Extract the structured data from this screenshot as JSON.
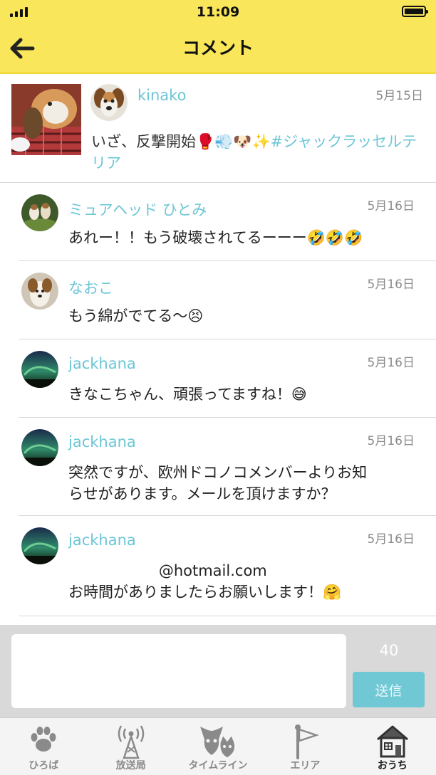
{
  "status_bar": {
    "time": "11:09"
  },
  "header": {
    "title": "コメント"
  },
  "post": {
    "user": "kinako",
    "date": "5月15日",
    "text": "いざ、反撃開始🥊💨🐶✨",
    "hashtag": "#ジャックラッセルテリア"
  },
  "comments": [
    {
      "user": "ミュアヘッド ひとみ",
      "date": "5月16日",
      "text": "あれー！！もう破壊されてるーーー🤣🤣🤣"
    },
    {
      "user": "なおこ",
      "date": "5月16日",
      "text": "もう綿がでてる〜😣"
    },
    {
      "user": "jackhana",
      "date": "5月16日",
      "text": "きなこちゃん、頑張ってますね！😅"
    },
    {
      "user": "jackhana",
      "date": "5月16日",
      "text": "突然ですが、欧州ドコノコメンバーよりお知\nらせがあります。メールを頂けますか？"
    },
    {
      "user": "jackhana",
      "date": "5月16日",
      "text": "                   @hotmail.com\nお時間がありましたらお願いします！🤗"
    }
  ],
  "composer": {
    "char_count": "40",
    "send_label": "送信",
    "placeholder": ""
  },
  "tabs": [
    {
      "label": "ひろば"
    },
    {
      "label": "放送局"
    },
    {
      "label": "タイムライン"
    },
    {
      "label": "エリア"
    },
    {
      "label": "おうち"
    }
  ],
  "colors": {
    "header_bg": "#f9e65a",
    "accent": "#6cc6d6",
    "send_button": "#70c8d4"
  }
}
